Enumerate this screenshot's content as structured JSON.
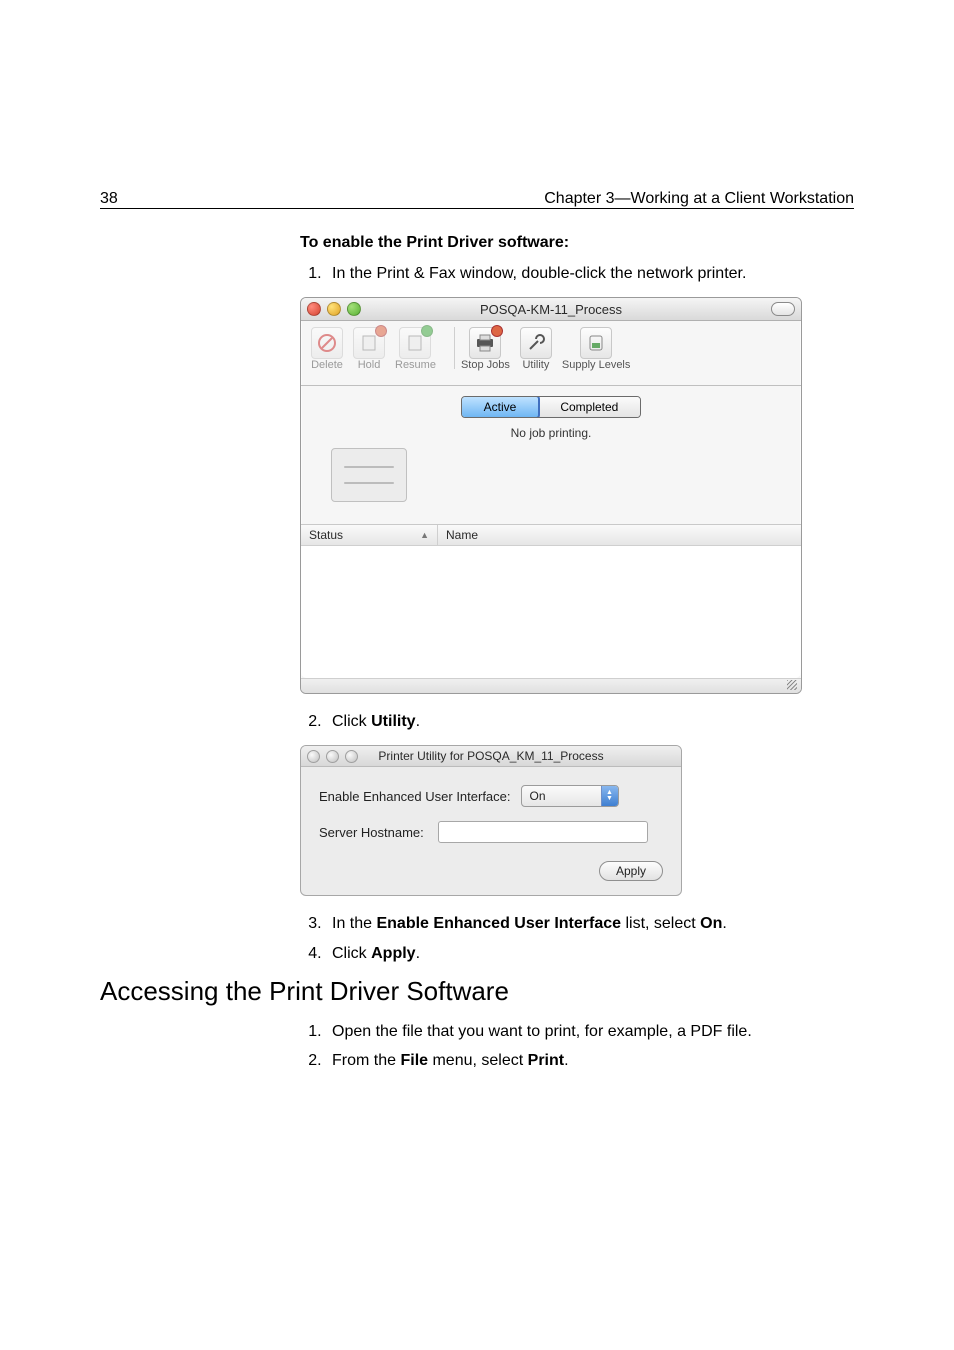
{
  "page_number": "38",
  "chapter": "Chapter 3—Working at a Client Workstation",
  "enable_heading": "To enable the Print Driver software:",
  "step1": "In the Print & Fax window, double-click the network printer.",
  "win1": {
    "title": "POSQA-KM-11_Process",
    "tb": {
      "delete": "Delete",
      "hold": "Hold",
      "resume": "Resume",
      "stop": "Stop Jobs",
      "utility": "Utility",
      "supply": "Supply Levels"
    },
    "tab_active": "Active",
    "tab_completed": "Completed",
    "no_job": "No job printing.",
    "col_status": "Status",
    "col_name": "Name"
  },
  "step2_prefix": "Click ",
  "step2_strong": "Utility",
  "step2_suffix": ".",
  "win2": {
    "title": "Printer Utility for POSQA_KM_11_Process",
    "eeui_label": "Enable Enhanced User Interface:",
    "eeui_value": "On",
    "hostname_label": "Server Hostname:",
    "apply": "Apply"
  },
  "step3_pre": "In the ",
  "step3_strong": "Enable Enhanced User Interface",
  "step3_mid": " list, select ",
  "step3_strong2": "On",
  "step3_suf": ".",
  "step4_pre": "Click ",
  "step4_strong": "Apply",
  "step4_suf": ".",
  "section_heading": "Accessing the Print Driver Software",
  "s2_step1": "Open the file that you want to print, for example, a PDF file.",
  "s2_step2_pre": "From the ",
  "s2_step2_strong1": "File",
  "s2_step2_mid": " menu, select ",
  "s2_step2_strong2": "Print",
  "s2_step2_suf": "."
}
